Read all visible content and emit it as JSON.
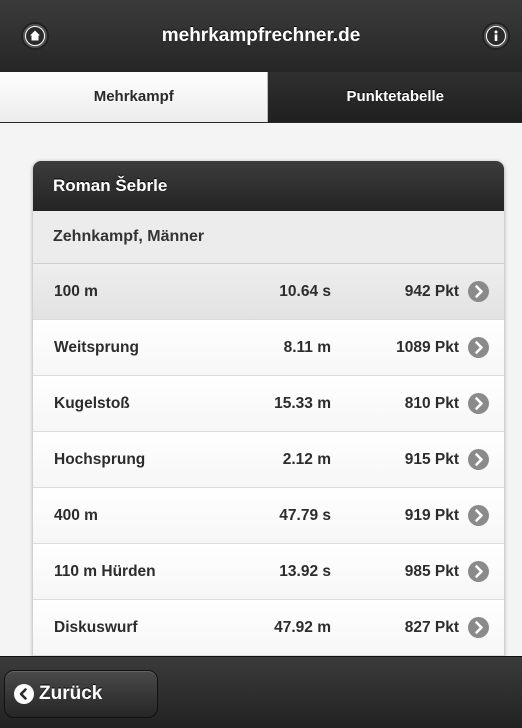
{
  "header": {
    "title": "mehrkampfrechner.de",
    "home_icon": "home-icon",
    "info_icon": "info-icon"
  },
  "tabs": [
    {
      "label": "Mehrkampf",
      "active": true
    },
    {
      "label": "Punktetabelle",
      "active": false
    }
  ],
  "card": {
    "athlete": "Roman Šebrle",
    "competition": "Zehnkampf, Männer",
    "rows": [
      {
        "discipline": "100 m",
        "performance": "10.64 s",
        "points": "942 Pkt"
      },
      {
        "discipline": "Weitsprung",
        "performance": "8.11 m",
        "points": "1089 Pkt"
      },
      {
        "discipline": "Kugelstoß",
        "performance": "15.33 m",
        "points": "810 Pkt"
      },
      {
        "discipline": "Hochsprung",
        "performance": "2.12 m",
        "points": "915 Pkt"
      },
      {
        "discipline": "400 m",
        "performance": "47.79 s",
        "points": "919 Pkt"
      },
      {
        "discipline": "110 m Hürden",
        "performance": "13.92 s",
        "points": "985 Pkt"
      },
      {
        "discipline": "Diskuswurf",
        "performance": "47.92 m",
        "points": "827 Pkt"
      },
      {
        "discipline": "",
        "performance": "",
        "points": ""
      }
    ]
  },
  "footer": {
    "back_label": "Zurück",
    "back_icon": "chevron-left-icon"
  },
  "colors": {
    "header_bg": "#2e2e2e",
    "row_arrow": "#8a8a8a",
    "highlight_row": "#e6e6e6"
  }
}
